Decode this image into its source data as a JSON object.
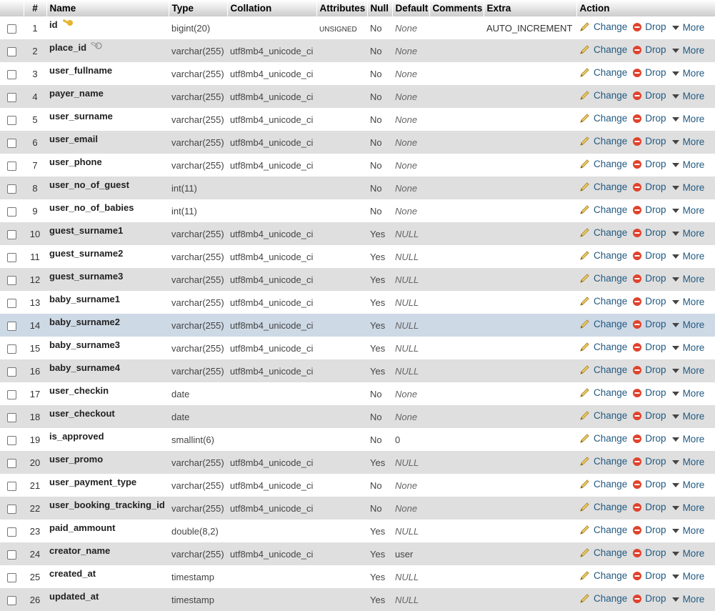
{
  "headers": {
    "num": "#",
    "name": "Name",
    "type": "Type",
    "collation": "Collation",
    "attributes": "Attributes",
    "null": "Null",
    "default": "Default",
    "comments": "Comments",
    "extra": "Extra",
    "action": "Action"
  },
  "actions": {
    "change": "Change",
    "drop": "Drop",
    "more": "More"
  },
  "colors": {
    "link": "#235a81",
    "row_alt": "#dfdfdf",
    "row_highlight": "#ced9e6",
    "drop_icon": "#e0432d",
    "key_primary": "#e6b42e",
    "key_index": "#9a9a9a"
  },
  "rows": [
    {
      "num": "1",
      "name": "id",
      "type": "bigint(20)",
      "collation": "",
      "attributes": "UNSIGNED",
      "null": "No",
      "default": "None",
      "extra": "AUTO_INCREMENT",
      "key": "primary"
    },
    {
      "num": "2",
      "name": "place_id",
      "type": "varchar(255)",
      "collation": "utf8mb4_unicode_ci",
      "attributes": "",
      "null": "No",
      "default": "None",
      "extra": "",
      "key": "index"
    },
    {
      "num": "3",
      "name": "user_fullname",
      "type": "varchar(255)",
      "collation": "utf8mb4_unicode_ci",
      "attributes": "",
      "null": "No",
      "default": "None",
      "extra": ""
    },
    {
      "num": "4",
      "name": "payer_name",
      "type": "varchar(255)",
      "collation": "utf8mb4_unicode_ci",
      "attributes": "",
      "null": "No",
      "default": "None",
      "extra": ""
    },
    {
      "num": "5",
      "name": "user_surname",
      "type": "varchar(255)",
      "collation": "utf8mb4_unicode_ci",
      "attributes": "",
      "null": "No",
      "default": "None",
      "extra": ""
    },
    {
      "num": "6",
      "name": "user_email",
      "type": "varchar(255)",
      "collation": "utf8mb4_unicode_ci",
      "attributes": "",
      "null": "No",
      "default": "None",
      "extra": ""
    },
    {
      "num": "7",
      "name": "user_phone",
      "type": "varchar(255)",
      "collation": "utf8mb4_unicode_ci",
      "attributes": "",
      "null": "No",
      "default": "None",
      "extra": ""
    },
    {
      "num": "8",
      "name": "user_no_of_guest",
      "type": "int(11)",
      "collation": "",
      "attributes": "",
      "null": "No",
      "default": "None",
      "extra": ""
    },
    {
      "num": "9",
      "name": "user_no_of_babies",
      "type": "int(11)",
      "collation": "",
      "attributes": "",
      "null": "No",
      "default": "None",
      "extra": ""
    },
    {
      "num": "10",
      "name": "guest_surname1",
      "type": "varchar(255)",
      "collation": "utf8mb4_unicode_ci",
      "attributes": "",
      "null": "Yes",
      "default": "NULL",
      "extra": ""
    },
    {
      "num": "11",
      "name": "guest_surname2",
      "type": "varchar(255)",
      "collation": "utf8mb4_unicode_ci",
      "attributes": "",
      "null": "Yes",
      "default": "NULL",
      "extra": ""
    },
    {
      "num": "12",
      "name": "guest_surname3",
      "type": "varchar(255)",
      "collation": "utf8mb4_unicode_ci",
      "attributes": "",
      "null": "Yes",
      "default": "NULL",
      "extra": ""
    },
    {
      "num": "13",
      "name": "baby_surname1",
      "type": "varchar(255)",
      "collation": "utf8mb4_unicode_ci",
      "attributes": "",
      "null": "Yes",
      "default": "NULL",
      "extra": ""
    },
    {
      "num": "14",
      "name": "baby_surname2",
      "type": "varchar(255)",
      "collation": "utf8mb4_unicode_ci",
      "attributes": "",
      "null": "Yes",
      "default": "NULL",
      "extra": "",
      "highlight": true
    },
    {
      "num": "15",
      "name": "baby_surname3",
      "type": "varchar(255)",
      "collation": "utf8mb4_unicode_ci",
      "attributes": "",
      "null": "Yes",
      "default": "NULL",
      "extra": ""
    },
    {
      "num": "16",
      "name": "baby_surname4",
      "type": "varchar(255)",
      "collation": "utf8mb4_unicode_ci",
      "attributes": "",
      "null": "Yes",
      "default": "NULL",
      "extra": ""
    },
    {
      "num": "17",
      "name": "user_checkin",
      "type": "date",
      "collation": "",
      "attributes": "",
      "null": "No",
      "default": "None",
      "extra": ""
    },
    {
      "num": "18",
      "name": "user_checkout",
      "type": "date",
      "collation": "",
      "attributes": "",
      "null": "No",
      "default": "None",
      "extra": ""
    },
    {
      "num": "19",
      "name": "is_approved",
      "type": "smallint(6)",
      "collation": "",
      "attributes": "",
      "null": "No",
      "default": "0",
      "extra": "",
      "default_plain": true
    },
    {
      "num": "20",
      "name": "user_promo",
      "type": "varchar(255)",
      "collation": "utf8mb4_unicode_ci",
      "attributes": "",
      "null": "Yes",
      "default": "NULL",
      "extra": ""
    },
    {
      "num": "21",
      "name": "user_payment_type",
      "type": "varchar(255)",
      "collation": "utf8mb4_unicode_ci",
      "attributes": "",
      "null": "No",
      "default": "None",
      "extra": ""
    },
    {
      "num": "22",
      "name": "user_booking_tracking_id",
      "type": "varchar(255)",
      "collation": "utf8mb4_unicode_ci",
      "attributes": "",
      "null": "No",
      "default": "None",
      "extra": ""
    },
    {
      "num": "23",
      "name": "paid_ammount",
      "type": "double(8,2)",
      "collation": "",
      "attributes": "",
      "null": "Yes",
      "default": "NULL",
      "extra": ""
    },
    {
      "num": "24",
      "name": "creator_name",
      "type": "varchar(255)",
      "collation": "utf8mb4_unicode_ci",
      "attributes": "",
      "null": "Yes",
      "default": "user",
      "extra": "",
      "default_plain": true
    },
    {
      "num": "25",
      "name": "created_at",
      "type": "timestamp",
      "collation": "",
      "attributes": "",
      "null": "Yes",
      "default": "NULL",
      "extra": ""
    },
    {
      "num": "26",
      "name": "updated_at",
      "type": "timestamp",
      "collation": "",
      "attributes": "",
      "null": "Yes",
      "default": "NULL",
      "extra": ""
    }
  ]
}
